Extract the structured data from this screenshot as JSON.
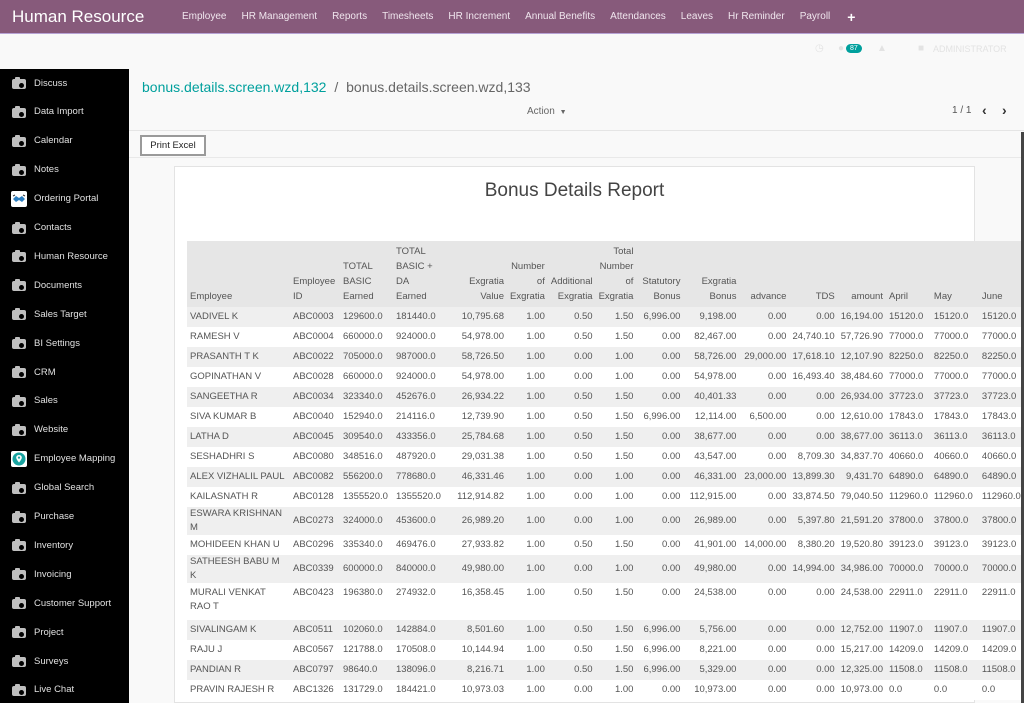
{
  "app": {
    "title": "Human Resource",
    "menu": [
      "Employee",
      "HR Management",
      "Reports",
      "Timesheets",
      "HR Increment",
      "Annual Benefits",
      "Attendances",
      "Leaves",
      "Hr Reminder",
      "Payroll"
    ],
    "menu_plus": "+",
    "messages_count": "87",
    "user": "ADMINISTRATOR",
    "accent_color": "#875a7b",
    "link_color": "#00a09d"
  },
  "sidebar": {
    "items": [
      {
        "label": "Discuss",
        "icon": "camera-icon"
      },
      {
        "label": "Data Import",
        "icon": "camera-icon"
      },
      {
        "label": "Calendar",
        "icon": "camera-icon"
      },
      {
        "label": "Notes",
        "icon": "camera-icon"
      },
      {
        "label": "Ordering Portal",
        "icon": "handshake-icon"
      },
      {
        "label": "Contacts",
        "icon": "camera-icon"
      },
      {
        "label": "Human Resource",
        "icon": "camera-icon"
      },
      {
        "label": "Documents",
        "icon": "camera-icon"
      },
      {
        "label": "Sales Target",
        "icon": "camera-icon"
      },
      {
        "label": "BI Settings",
        "icon": "camera-icon"
      },
      {
        "label": "CRM",
        "icon": "camera-icon"
      },
      {
        "label": "Sales",
        "icon": "camera-icon"
      },
      {
        "label": "Website",
        "icon": "camera-icon"
      },
      {
        "label": "Employee Mapping",
        "icon": "map-pin-icon"
      },
      {
        "label": "Global Search",
        "icon": "camera-icon"
      },
      {
        "label": "Purchase",
        "icon": "camera-icon"
      },
      {
        "label": "Inventory",
        "icon": "camera-icon"
      },
      {
        "label": "Invoicing",
        "icon": "camera-icon"
      },
      {
        "label": "Customer Support",
        "icon": "camera-icon"
      },
      {
        "label": "Project",
        "icon": "camera-icon"
      },
      {
        "label": "Surveys",
        "icon": "camera-icon"
      },
      {
        "label": "Live Chat",
        "icon": "camera-icon"
      }
    ]
  },
  "breadcrumb": {
    "parent": "bonus.details.screen.wzd,132",
    "separator": "/",
    "current": "bonus.details.screen.wzd,133"
  },
  "controls": {
    "action_label": "Action",
    "pager": "1 / 1",
    "print_excel_label": "Print Excel"
  },
  "report": {
    "title": "Bonus Details Report",
    "columns": [
      [
        "Employee"
      ],
      [
        "Employee",
        "ID"
      ],
      [
        "TOTAL",
        "BASIC",
        "Earned"
      ],
      [
        "TOTAL",
        "BASIC +",
        "DA",
        "Earned"
      ],
      [
        "Exgratia",
        "Value"
      ],
      [
        "Number",
        "of",
        "Exgratia"
      ],
      [
        "Additional",
        "Exgratia"
      ],
      [
        "Total",
        "Number",
        "of",
        "Exgratia"
      ],
      [
        "Statutory",
        "Bonus"
      ],
      [
        "Exgratia",
        "Bonus"
      ],
      [
        "advance"
      ],
      [
        "TDS"
      ],
      [
        "amount"
      ],
      [
        "April"
      ],
      [
        "May"
      ],
      [
        "June"
      ]
    ],
    "rows": [
      [
        "VADIVEL K",
        "ABC0003",
        "129600.0",
        "181440.0",
        "10,795.68",
        "1.00",
        "0.50",
        "1.50",
        "6,996.00",
        "9,198.00",
        "0.00",
        "0.00",
        "16,194.00",
        "15120.0",
        "15120.0",
        "15120.0"
      ],
      [
        "RAMESH V",
        "ABC0004",
        "660000.0",
        "924000.0",
        "54,978.00",
        "1.00",
        "0.50",
        "1.50",
        "0.00",
        "82,467.00",
        "0.00",
        "24,740.10",
        "57,726.90",
        "77000.0",
        "77000.0",
        "77000.0"
      ],
      [
        "PRASANTH T K",
        "ABC0022",
        "705000.0",
        "987000.0",
        "58,726.50",
        "1.00",
        "0.00",
        "1.00",
        "0.00",
        "58,726.00",
        "29,000.00",
        "17,618.10",
        "12,107.90",
        "82250.0",
        "82250.0",
        "82250.0"
      ],
      [
        "GOPINATHAN V",
        "ABC0028",
        "660000.0",
        "924000.0",
        "54,978.00",
        "1.00",
        "0.00",
        "1.00",
        "0.00",
        "54,978.00",
        "0.00",
        "16,493.40",
        "38,484.60",
        "77000.0",
        "77000.0",
        "77000.0"
      ],
      [
        "SANGEETHA R",
        "ABC0034",
        "323340.0",
        "452676.0",
        "26,934.22",
        "1.00",
        "0.50",
        "1.50",
        "0.00",
        "40,401.33",
        "0.00",
        "0.00",
        "26,934.00",
        "37723.0",
        "37723.0",
        "37723.0"
      ],
      [
        "SIVA KUMAR B",
        "ABC0040",
        "152940.0",
        "214116.0",
        "12,739.90",
        "1.00",
        "0.50",
        "1.50",
        "6,996.00",
        "12,114.00",
        "6,500.00",
        "0.00",
        "12,610.00",
        "17843.0",
        "17843.0",
        "17843.0"
      ],
      [
        "LATHA D",
        "ABC0045",
        "309540.0",
        "433356.0",
        "25,784.68",
        "1.00",
        "0.50",
        "1.50",
        "0.00",
        "38,677.00",
        "0.00",
        "0.00",
        "38,677.00",
        "36113.0",
        "36113.0",
        "36113.0"
      ],
      [
        "SESHADHRI S",
        "ABC0080",
        "348516.0",
        "487920.0",
        "29,031.38",
        "1.00",
        "0.50",
        "1.50",
        "0.00",
        "43,547.00",
        "0.00",
        "8,709.30",
        "34,837.70",
        "40660.0",
        "40660.0",
        "40660.0"
      ],
      [
        "ALEX VIZHALIL PAUL",
        "ABC0082",
        "556200.0",
        "778680.0",
        "46,331.46",
        "1.00",
        "0.00",
        "1.00",
        "0.00",
        "46,331.00",
        "23,000.00",
        "13,899.30",
        "9,431.70",
        "64890.0",
        "64890.0",
        "64890.0"
      ],
      [
        "KAILASNATH R",
        "ABC0128",
        "1355520.0",
        "1355520.0",
        "112,914.82",
        "1.00",
        "0.00",
        "1.00",
        "0.00",
        "112,915.00",
        "0.00",
        "33,874.50",
        "79,040.50",
        "112960.0",
        "112960.0",
        "112960.0"
      ],
      [
        "ESWARA KRISHNAN M",
        "ABC0273",
        "324000.0",
        "453600.0",
        "26,989.20",
        "1.00",
        "0.00",
        "1.00",
        "0.00",
        "26,989.00",
        "0.00",
        "5,397.80",
        "21,591.20",
        "37800.0",
        "37800.0",
        "37800.0"
      ],
      [
        "MOHIDEEN KHAN U",
        "ABC0296",
        "335340.0",
        "469476.0",
        "27,933.82",
        "1.00",
        "0.50",
        "1.50",
        "0.00",
        "41,901.00",
        "14,000.00",
        "8,380.20",
        "19,520.80",
        "39123.0",
        "39123.0",
        "39123.0"
      ],
      [
        "SATHEESH BABU M K",
        "ABC0339",
        "600000.0",
        "840000.0",
        "49,980.00",
        "1.00",
        "0.00",
        "1.00",
        "0.00",
        "49,980.00",
        "0.00",
        "14,994.00",
        "34,986.00",
        "70000.0",
        "70000.0",
        "70000.0"
      ],
      [
        "MURALI VENKAT RAO T",
        "ABC0423",
        "196380.0",
        "274932.0",
        "16,358.45",
        "1.00",
        "0.50",
        "1.50",
        "0.00",
        "24,538.00",
        "0.00",
        "0.00",
        "24,538.00",
        "22911.0",
        "22911.0",
        "22911.0"
      ],
      [
        "SIVALINGAM K",
        "ABC0511",
        "102060.0",
        "142884.0",
        "8,501.60",
        "1.00",
        "0.50",
        "1.50",
        "6,996.00",
        "5,756.00",
        "0.00",
        "0.00",
        "12,752.00",
        "11907.0",
        "11907.0",
        "11907.0"
      ],
      [
        "RAJU J",
        "ABC0567",
        "121788.0",
        "170508.0",
        "10,144.94",
        "1.00",
        "0.50",
        "1.50",
        "6,996.00",
        "8,221.00",
        "0.00",
        "0.00",
        "15,217.00",
        "14209.0",
        "14209.0",
        "14209.0"
      ],
      [
        "PANDIAN R",
        "ABC0797",
        "98640.0",
        "138096.0",
        "8,216.71",
        "1.00",
        "0.50",
        "1.50",
        "6,996.00",
        "5,329.00",
        "0.00",
        "0.00",
        "12,325.00",
        "11508.0",
        "11508.0",
        "11508.0"
      ],
      [
        "PRAVIN RAJESH R",
        "ABC1326",
        "131729.0",
        "184421.0",
        "10,973.03",
        "1.00",
        "0.00",
        "1.00",
        "0.00",
        "10,973.00",
        "0.00",
        "0.00",
        "10,973.00",
        "0.0",
        "0.0",
        "0.0"
      ]
    ]
  }
}
